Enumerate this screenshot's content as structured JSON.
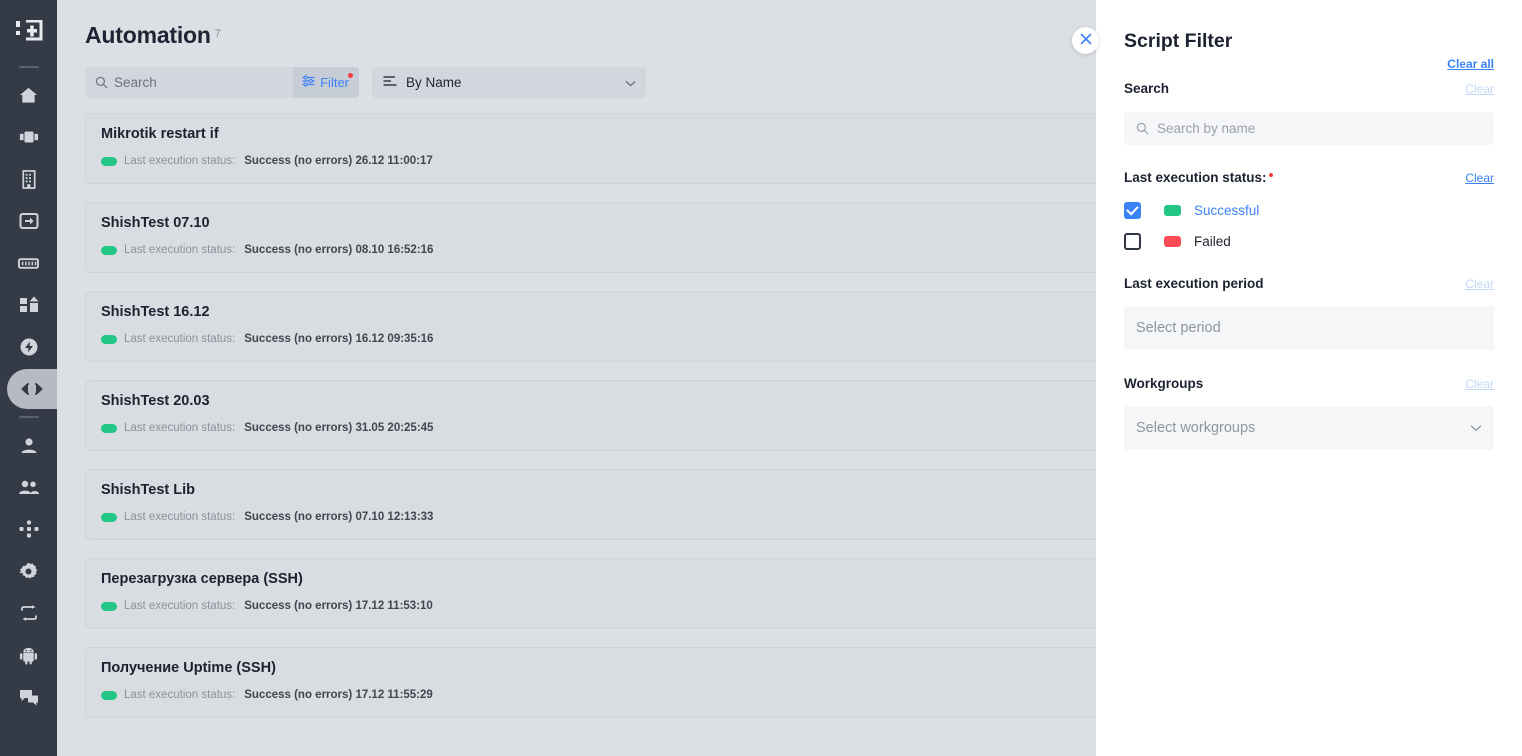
{
  "sidebar": {
    "logo_icon": "app-logo-icon",
    "items": [
      {
        "icon": "home-icon",
        "name": "sidebar-item-home",
        "active": false
      },
      {
        "icon": "server-rack-icon",
        "name": "sidebar-item-devices",
        "active": false
      },
      {
        "icon": "grid-building-icon",
        "name": "sidebar-item-inventory",
        "active": false
      },
      {
        "icon": "inbox-download-icon",
        "name": "sidebar-item-inbox",
        "active": false
      },
      {
        "icon": "ruler-icon",
        "name": "sidebar-item-measurements",
        "active": false
      },
      {
        "icon": "dashboard-blocks-icon",
        "name": "sidebar-item-dashboards",
        "active": false
      },
      {
        "icon": "bolt-circle-icon",
        "name": "sidebar-item-alerts",
        "active": false
      },
      {
        "icon": "code-brackets-icon",
        "name": "sidebar-item-automation",
        "active": true
      },
      {
        "icon": "user-icon",
        "name": "sidebar-item-user",
        "active": false
      },
      {
        "icon": "users-icon",
        "name": "sidebar-item-groups",
        "active": false
      },
      {
        "icon": "network-nodes-icon",
        "name": "sidebar-item-topology",
        "active": false
      },
      {
        "icon": "gear-icon",
        "name": "sidebar-item-settings",
        "active": false
      },
      {
        "icon": "sync-arrows-icon",
        "name": "sidebar-item-sync",
        "active": false
      },
      {
        "icon": "android-icon",
        "name": "sidebar-item-android",
        "active": false
      },
      {
        "icon": "chat-icon",
        "name": "sidebar-item-chat",
        "active": false
      }
    ]
  },
  "header": {
    "title": "Automation",
    "count": "7"
  },
  "toolbar": {
    "search_placeholder": "Search",
    "search_value": "",
    "filter_label": "Filter",
    "filter_has_badge": true,
    "sort_label": "By Name"
  },
  "list": {
    "status_label": "Last execution status:",
    "items": [
      {
        "title": "Mikrotik restart if",
        "status_color": "#22c786",
        "status_value": "Success (no errors) 26.12 11:00:17"
      },
      {
        "title": "ShishTest 07.10",
        "status_color": "#22c786",
        "status_value": "Success (no errors) 08.10 16:52:16"
      },
      {
        "title": "ShishTest 16.12",
        "status_color": "#22c786",
        "status_value": "Success (no errors) 16.12 09:35:16"
      },
      {
        "title": "ShishTest 20.03",
        "status_color": "#22c786",
        "status_value": "Success (no errors) 31.05 20:25:45"
      },
      {
        "title": "ShishTest Lib",
        "status_color": "#22c786",
        "status_value": "Success (no errors) 07.10 12:13:33"
      },
      {
        "title": "Перезагрузка сервера (SSH)",
        "status_color": "#22c786",
        "status_value": "Success (no errors) 17.12 11:53:10"
      },
      {
        "title": "Получение Uptime (SSH)",
        "status_color": "#22c786",
        "status_value": "Success (no errors) 17.12 11:55:29"
      }
    ]
  },
  "panel": {
    "title": "Script Filter",
    "close_icon": "close-icon",
    "clear_all_label": "Clear all",
    "search": {
      "title": "Search",
      "clear_label": "Clear",
      "clear_disabled": true,
      "placeholder": "Search by name",
      "value": ""
    },
    "status": {
      "title": "Last execution status:",
      "required": true,
      "clear_label": "Clear",
      "clear_disabled": false,
      "options": [
        {
          "label": "Successful",
          "checked": true,
          "chip_color": "#22c786",
          "label_color": "#3b82f6"
        },
        {
          "label": "Failed",
          "checked": false,
          "chip_color": "#fb4b57",
          "label_color": "#1c2230"
        }
      ]
    },
    "period": {
      "title": "Last execution period",
      "clear_label": "Clear",
      "clear_disabled": true,
      "placeholder": "Select period",
      "value": ""
    },
    "workgroups": {
      "title": "Workgroups",
      "clear_label": "Clear",
      "clear_disabled": true,
      "placeholder": "Select workgroups",
      "value": "",
      "chevron_icon": "chevron-down-icon"
    }
  },
  "colors": {
    "accent_blue": "#3b82f6",
    "success_green": "#22c786",
    "fail_red": "#fb4b57",
    "sidebar_bg": "#343a46",
    "page_bg": "#dcdfe3",
    "panel_bg": "#ffffff"
  }
}
